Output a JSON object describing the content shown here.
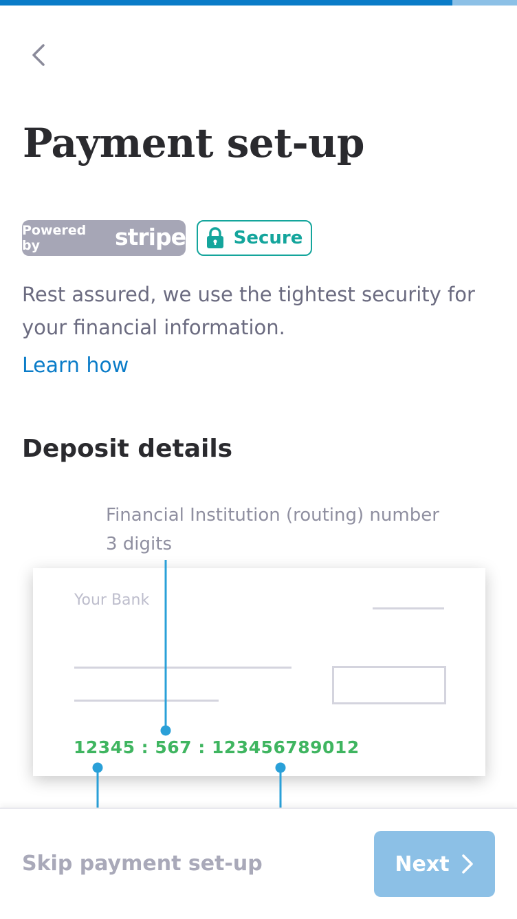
{
  "progress": {
    "fraction": 0.875
  },
  "nav": {
    "back_icon": "chevron-left-icon"
  },
  "title": "Payment set-up",
  "badges": {
    "powered_by": "Powered by",
    "stripe": "stripe",
    "secure": "Secure",
    "secure_icon": "lock-icon"
  },
  "intro": {
    "text": "Rest assured, we use the tightest security for your financial information.",
    "link": "Learn how"
  },
  "deposit": {
    "heading": "Deposit details",
    "label_line1": "Financial Institution (routing) number",
    "label_line2": "3 digits",
    "cheque": {
      "bank_name": "Your Bank",
      "micr": "12345 : 567 : 123456789012"
    }
  },
  "footer": {
    "skip": "Skip payment set-up",
    "next": "Next",
    "next_icon": "chevron-right-icon"
  },
  "colors": {
    "accent": "#0a7cc8",
    "progress_bg": "#8cc0e6",
    "secure_green": "#14a59c",
    "micr_green": "#3fb560",
    "connector_blue": "#2aa0d8",
    "next_button": "#8cc0e6"
  }
}
